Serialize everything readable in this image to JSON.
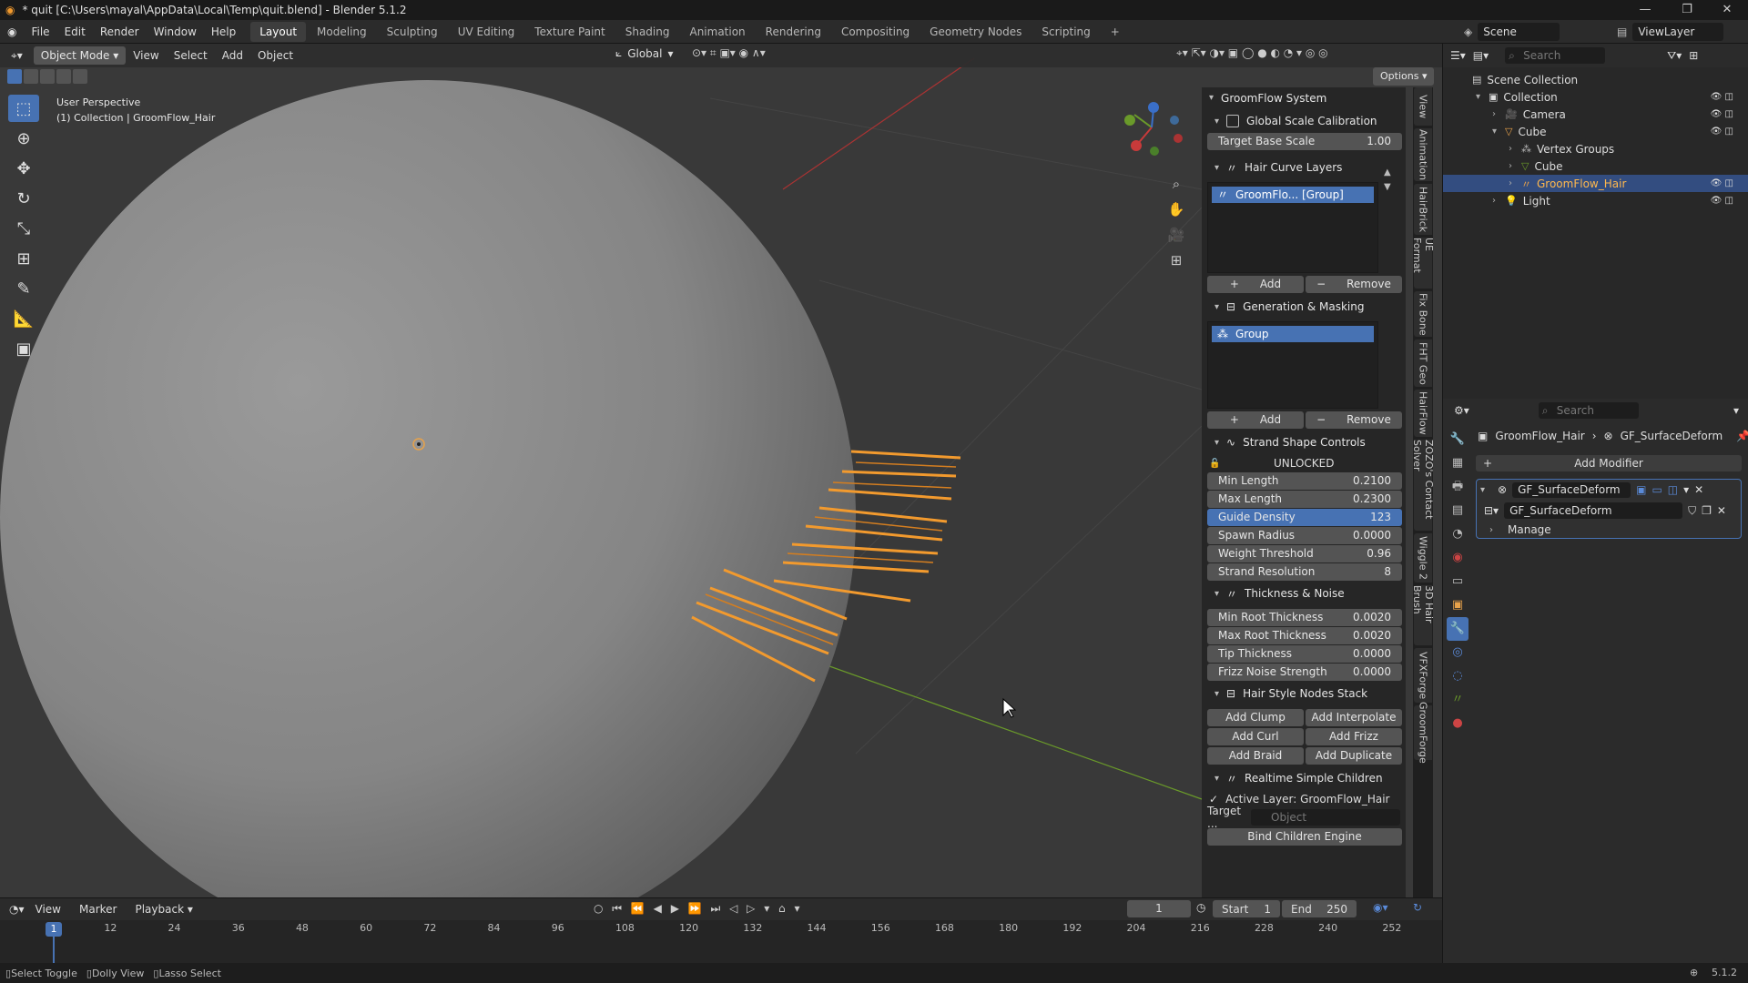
{
  "title_bar": {
    "text": "* quit [C:\\Users\\mayal\\AppData\\Local\\Temp\\quit.blend] - Blender 5.1.2"
  },
  "menu": {
    "items": [
      "File",
      "Edit",
      "Render",
      "Window",
      "Help"
    ]
  },
  "workspaces": [
    {
      "label": "Layout",
      "active": true
    },
    {
      "label": "Modeling"
    },
    {
      "label": "Sculpting"
    },
    {
      "label": "UV Editing"
    },
    {
      "label": "Texture Paint"
    },
    {
      "label": "Shading"
    },
    {
      "label": "Animation"
    },
    {
      "label": "Rendering"
    },
    {
      "label": "Compositing"
    },
    {
      "label": "Geometry Nodes"
    },
    {
      "label": "Scripting"
    }
  ],
  "scene": {
    "name": "Scene",
    "view_layer": "ViewLayer"
  },
  "viewport": {
    "mode": "Object Mode",
    "menus": [
      "View",
      "Select",
      "Add",
      "Object"
    ],
    "orientation": "Global",
    "options_label": "Options",
    "overlay_line1": "User Perspective",
    "overlay_line2": "(1) Collection | GroomFlow_Hair"
  },
  "npanel": {
    "title": "GroomFlow System",
    "global_scale": {
      "label": "Global Scale Calibration",
      "field_label": "Target Base Scale",
      "field_value": "1.00"
    },
    "hair_curve_layers": {
      "label": "Hair Curve Layers",
      "item": "GroomFlo...  [Group]",
      "add": "Add",
      "remove": "Remove"
    },
    "generation": {
      "label": "Generation & Masking",
      "item": "Group",
      "add": "Add",
      "remove": "Remove"
    },
    "strand_shape": {
      "label": "Strand Shape Controls",
      "lock_text": "UNLOCKED",
      "fields": [
        {
          "label": "Min Length",
          "value": "0.2100"
        },
        {
          "label": "Max Length",
          "value": "0.2300"
        },
        {
          "label": "Guide Density",
          "value": "123",
          "selected": true
        },
        {
          "label": "Spawn Radius",
          "value": "0.0000"
        },
        {
          "label": "Weight Threshold",
          "value": "0.96"
        },
        {
          "label": "Strand Resolution",
          "value": "8"
        }
      ]
    },
    "thickness": {
      "label": "Thickness & Noise",
      "fields": [
        {
          "label": "Min Root Thickness",
          "value": "0.0020"
        },
        {
          "label": "Max Root Thickness",
          "value": "0.0020"
        },
        {
          "label": "Tip Thickness",
          "value": "0.0000"
        },
        {
          "label": "Frizz Noise Strength",
          "value": "0.0000"
        }
      ]
    },
    "style_nodes": {
      "label": "Hair Style Nodes Stack",
      "buttons": [
        "Add Clump",
        "Add Interpolate",
        "Add Curl",
        "Add Frizz",
        "Add Braid",
        "Add Duplicate"
      ]
    },
    "realtime": {
      "label": "Realtime Simple Children",
      "active_layer": "Active Layer: GroomFlow_Hair",
      "target_label": "Target ...",
      "target_placeholder": "Object",
      "bind_label": "Bind Children Engine"
    }
  },
  "side_tabs": [
    "View",
    "Animation",
    "HairBrick",
    "UE Format",
    "Fix Bone",
    "FHT Geo",
    "HairFlow",
    "ZOZO's Contact Solver",
    "Wiggle 2",
    "3D Hair Brush",
    "VFXForge",
    "GroomForge"
  ],
  "outliner": {
    "search_placeholder": "Search",
    "rows": [
      {
        "label": "Scene Collection",
        "indent": 0
      },
      {
        "label": "Collection",
        "indent": 1
      },
      {
        "label": "Camera",
        "indent": 2
      },
      {
        "label": "Cube",
        "indent": 2
      },
      {
        "label": "Vertex Groups",
        "indent": 3
      },
      {
        "label": "Cube",
        "indent": 3
      },
      {
        "label": "GroomFlow_Hair",
        "indent": 3,
        "selected": true
      },
      {
        "label": "Light",
        "indent": 2
      }
    ]
  },
  "properties": {
    "search_placeholder": "Search",
    "breadcrumb_object": "GroomFlow_Hair",
    "breadcrumb_modifier": "GF_SurfaceDeform",
    "add_modifier": "Add Modifier",
    "modifier_name": "GF_SurfaceDeform",
    "nodegroup_name": "GF_SurfaceDeform",
    "manage": "Manage"
  },
  "timeline": {
    "menus": [
      "View",
      "Marker",
      "Playback"
    ],
    "current_frame": "1",
    "start_label": "Start",
    "start": "1",
    "end_label": "End",
    "end": "250",
    "ticks": [
      "1",
      "12",
      "24",
      "36",
      "48",
      "60",
      "72",
      "84",
      "96",
      "108",
      "120",
      "132",
      "144",
      "156",
      "168",
      "180",
      "192",
      "204",
      "216",
      "228",
      "240",
      "252"
    ]
  },
  "statusbar": {
    "items": [
      "Select Toggle",
      "Dolly View",
      "Lasso Select"
    ],
    "version": "5.1.2"
  },
  "colors": {
    "accent": "#4772b3",
    "hair": "#f29a2e",
    "selected_row": "#334d80"
  }
}
